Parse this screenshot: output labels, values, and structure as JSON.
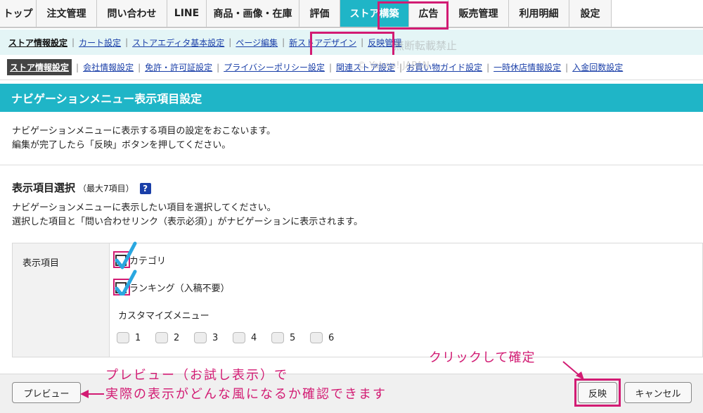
{
  "topnav": {
    "tabs": [
      {
        "label": "トップ",
        "w": 52
      },
      {
        "label": "注文管理",
        "w": 86
      },
      {
        "label": "問い合わせ",
        "w": 100
      },
      {
        "label": "LINE",
        "w": 56
      },
      {
        "label": "商品・画像・在庫",
        "w": 132
      },
      {
        "label": "評価",
        "w": 58
      },
      {
        "label": "ストア構築",
        "w": 98
      },
      {
        "label": "広告",
        "w": 56
      },
      {
        "label": "販売管理",
        "w": 86
      },
      {
        "label": "利用明細",
        "w": 86
      },
      {
        "label": "設定",
        "w": 60
      }
    ]
  },
  "subnav1": {
    "items": [
      "ストア情報設定",
      "カート設定",
      "ストアエディタ基本設定",
      "ページ編集",
      "新ストアデザイン",
      "反映管理"
    ],
    "watermark": "無断転載禁止"
  },
  "subnav2": {
    "items": [
      "ストア情報設定",
      "会社情報設定",
      "免許・許可証設定",
      "プライバシーポリシー設定",
      "関連ストア設定",
      "お買い物ガイド設定",
      "一時休店情報設定",
      "入金回数設定"
    ],
    "watermark": "© Yahoo! JAPAN"
  },
  "section": {
    "title": "ナビゲーションメニュー表示項目設定"
  },
  "desc": {
    "line1": "ナビゲーションメニューに表示する項目の設定をおこないます。",
    "line2": "編集が完了したら「反映」ボタンを押してください。"
  },
  "select": {
    "title": "表示項目選択",
    "sub": "（最大7項目）",
    "help": "?",
    "line1": "ナビゲーションメニューに表示したい項目を選択してください。",
    "line2": "選択した項目と「問い合わせリンク（表示必須）」がナビゲーションに表示されます。"
  },
  "table": {
    "label": "表示項目",
    "options": [
      "カテゴリ",
      "ランキング（入稿不要）"
    ],
    "custom_label": "カスタマイズメニュー",
    "custom_numbers": [
      "1",
      "2",
      "3",
      "4",
      "5",
      "6"
    ]
  },
  "buttons": {
    "preview": "プレビュー",
    "apply": "反映",
    "cancel": "キャンセル"
  },
  "callouts": {
    "apply_note": "クリックして確定",
    "preview_line1": "プレビュー（お試し表示）で",
    "preview_line2": "実際の表示がどんな風になるか確認できます"
  },
  "colors": {
    "accent": "#1fb5c7",
    "highlight": "#d21b73",
    "link": "#1a3fa8",
    "check": "#2aa7e0"
  }
}
